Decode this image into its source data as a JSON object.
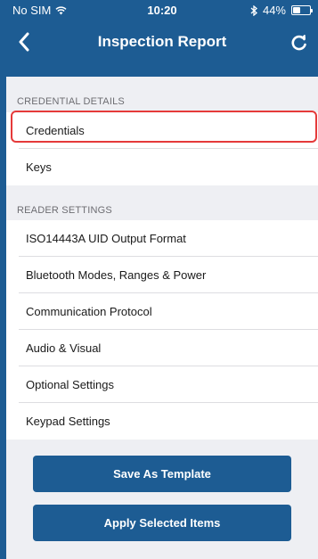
{
  "status_bar": {
    "carrier": "No SIM",
    "time": "10:20",
    "battery": "44%",
    "battery_level": 0.44
  },
  "nav": {
    "title": "Inspection Report",
    "back_icon": "chevron-left-icon",
    "refresh_icon": "refresh-icon"
  },
  "sections": [
    {
      "header": "CREDENTIAL DETAILS",
      "items": [
        {
          "label": "Credentials",
          "selected": true
        },
        {
          "label": "Keys"
        }
      ]
    },
    {
      "header": "READER SETTINGS",
      "items": [
        {
          "label": "ISO14443A UID Output Format"
        },
        {
          "label": "Bluetooth Modes, Ranges & Power"
        },
        {
          "label": "Communication Protocol"
        },
        {
          "label": "Audio & Visual"
        },
        {
          "label": "Optional Settings"
        },
        {
          "label": "Keypad Settings"
        }
      ]
    }
  ],
  "buttons": {
    "save_template": "Save As Template",
    "apply_selected": "Apply Selected Items"
  },
  "colors": {
    "primary": "#1d5c93",
    "highlight": "#e53a3a",
    "background": "#eeeff3"
  }
}
